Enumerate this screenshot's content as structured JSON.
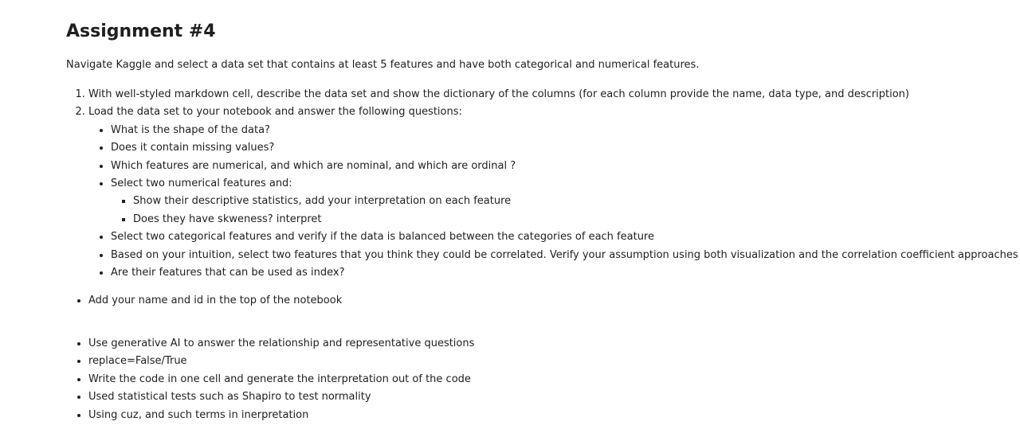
{
  "title": "Assignment #4",
  "intro": "Navigate Kaggle and select a data set that contains at least 5 features and have both categorical and numerical features.",
  "steps": [
    "With well-styled markdown cell, describe the data set and show the dictionary of the columns (for each column provide the name, data type, and description)",
    "Load the data set to your notebook and answer the following questions:"
  ],
  "questions": {
    "q1": "What is the shape of the data?",
    "q2": "Does it contain missing values?",
    "q3": "Which features are numerical, and which are nominal, and which are ordinal ?",
    "q4": "Select two numerical features and:",
    "q4_sub": [
      "Show their descriptive statistics, add your interpretation on each feature",
      "Does they have skweness? interpret"
    ],
    "q5": "Select two categorical features and verify if the data is balanced between the categories of each feature",
    "q6": "Based on your intuition, select two features that you think they could be correlated. Verify your assumption using both visualization and the correlation coefficient approaches",
    "q7": "Are their features that can be used as index?"
  },
  "note": "Add your name and id in the top of the notebook",
  "extras": [
    "Use generative AI to answer the relationship and representative questions",
    "replace=False/True",
    "Write the code in one cell and generate the interpretation out of the code",
    "Used statistical tests such as Shapiro to test normality",
    "Using cuz, and such terms in inerpretation"
  ]
}
